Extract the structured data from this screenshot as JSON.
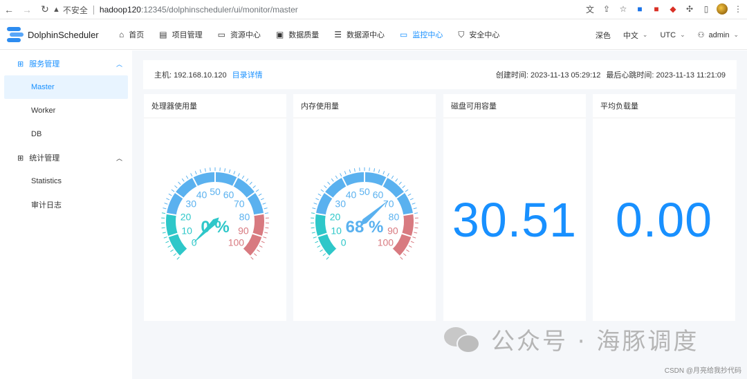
{
  "browser": {
    "insecure_label": "不安全",
    "url_host": "hadoop120",
    "url_path": ":12345/dolphinscheduler/ui/monitor/master"
  },
  "header": {
    "logo_text": "DolphinScheduler",
    "menu": [
      {
        "label": "首页",
        "icon": "home-icon"
      },
      {
        "label": "项目管理",
        "icon": "project-icon"
      },
      {
        "label": "资源中心",
        "icon": "folder-icon"
      },
      {
        "label": "数据质量",
        "icon": "quality-icon"
      },
      {
        "label": "数据源中心",
        "icon": "datasource-icon"
      },
      {
        "label": "监控中心",
        "icon": "monitor-icon",
        "active": true
      },
      {
        "label": "安全中心",
        "icon": "shield-icon"
      }
    ],
    "theme": "深色",
    "language": "中文",
    "timezone": "UTC",
    "user": "admin"
  },
  "sidebar": {
    "groups": [
      {
        "label": "服务管理",
        "items": [
          "Master",
          "Worker",
          "DB"
        ]
      },
      {
        "label": "统计管理",
        "items": [
          "Statistics",
          "审计日志"
        ]
      }
    ]
  },
  "info": {
    "host_label": "主机: 192.168.10.120",
    "detail_link": "目录详情",
    "created": "创建时间: 2023-11-13 05:29:12",
    "heartbeat": "最后心跳时间: 2023-11-13 11:21:09"
  },
  "cards": {
    "cpu": {
      "title": "处理器使用量",
      "value": 0,
      "label": "0 %"
    },
    "memory": {
      "title": "内存使用量",
      "value": 68,
      "label": "68 %"
    },
    "disk": {
      "title": "磁盘可用容量",
      "value": "30.51"
    },
    "load": {
      "title": "平均负载量",
      "value": "0.00"
    }
  },
  "gauge_ticks": [
    "0",
    "10",
    "20",
    "30",
    "40",
    "50",
    "60",
    "70",
    "80",
    "90",
    "100"
  ],
  "colors": {
    "accent": "#1890ff",
    "gauge_low": "#2ec7c9",
    "gauge_mid": "#5ab1ef",
    "gauge_high": "#d87a80"
  },
  "watermark": {
    "text": "公众号 · 海豚调度",
    "credit": "CSDN @月亮给我抄代码"
  }
}
